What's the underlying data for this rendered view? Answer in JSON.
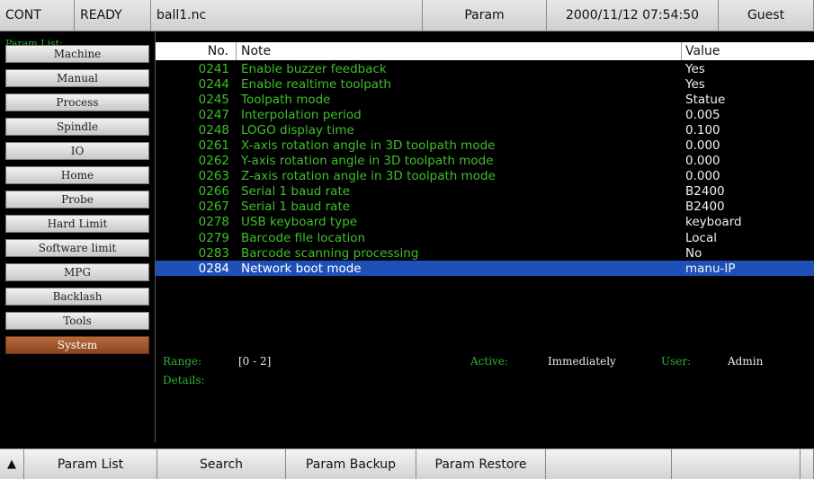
{
  "topbar": {
    "mode": "CONT",
    "status": "READY",
    "filename": "ball1.nc",
    "page": "Param",
    "datetime": "2000/11/12 07:54:50",
    "user": "Guest"
  },
  "sidebar": {
    "title": "Param List:",
    "items": [
      {
        "label": "Machine"
      },
      {
        "label": "Manual"
      },
      {
        "label": "Process"
      },
      {
        "label": "Spindle"
      },
      {
        "label": "IO"
      },
      {
        "label": "Home"
      },
      {
        "label": "Probe"
      },
      {
        "label": "Hard Limit"
      },
      {
        "label": "Software limit"
      },
      {
        "label": "MPG"
      },
      {
        "label": "Backlash"
      },
      {
        "label": "Tools"
      },
      {
        "label": "System",
        "active": true
      }
    ]
  },
  "table": {
    "headers": {
      "no": "No.",
      "note": "Note",
      "value": "Value"
    },
    "rows": [
      {
        "no": "0241",
        "note": "Enable buzzer feedback",
        "value": "Yes"
      },
      {
        "no": "0244",
        "note": "Enable realtime toolpath",
        "value": "Yes"
      },
      {
        "no": "0245",
        "note": "Toolpath mode",
        "value": "Statue"
      },
      {
        "no": "0247",
        "note": "Interpolation period",
        "value": "0.005"
      },
      {
        "no": "0248",
        "note": "LOGO display time",
        "value": "0.100"
      },
      {
        "no": "0261",
        "note": "X-axis rotation angle in 3D toolpath mode",
        "value": "0.000"
      },
      {
        "no": "0262",
        "note": "Y-axis rotation angle in 3D toolpath mode",
        "value": "0.000"
      },
      {
        "no": "0263",
        "note": "Z-axis rotation angle in 3D toolpath mode",
        "value": "0.000"
      },
      {
        "no": "0266",
        "note": "Serial 1 baud rate",
        "value": "B2400"
      },
      {
        "no": "0267",
        "note": "Serial 1 baud rate",
        "value": "B2400"
      },
      {
        "no": "0278",
        "note": "USB keyboard type",
        "value": "keyboard"
      },
      {
        "no": "0279",
        "note": "Barcode file location",
        "value": "Local"
      },
      {
        "no": "0283",
        "note": "Barcode scanning processing",
        "value": "No"
      },
      {
        "no": "0284",
        "note": "Network boot mode",
        "value": "manu-IP",
        "selected": true
      }
    ]
  },
  "info": {
    "range_label": "Range:",
    "range_value": "[0 - 2]",
    "active_label": "Active:",
    "active_value": "Immediately",
    "user_label": "User:",
    "user_value": "Admin",
    "details_label": "Details:"
  },
  "bottombar": {
    "arrow": "▲",
    "buttons": [
      "Param List",
      "Search",
      "Param Backup",
      "Param Restore",
      "",
      "",
      ""
    ]
  }
}
